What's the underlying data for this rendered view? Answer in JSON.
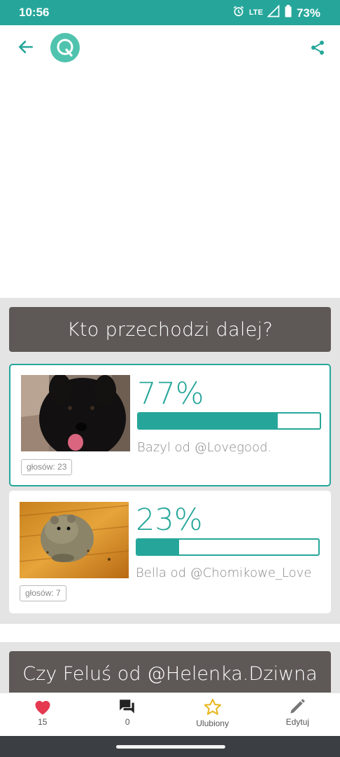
{
  "status_bar": {
    "time": "10:56",
    "network": "LTE",
    "battery": "73%"
  },
  "app_bar": {
    "logo_letter": "Q"
  },
  "poll": {
    "question": "Kto przechodzi dalej?",
    "options": [
      {
        "percent_label": "77%",
        "percent": 77,
        "label": "Bazyl od @Lovegood.",
        "votes": "głosów: 23",
        "selected": true
      },
      {
        "percent_label": "23%",
        "percent": 23,
        "label": "Bella od @Chomikowe_Love",
        "votes": "głosów: 7",
        "selected": false
      }
    ]
  },
  "next_poll": {
    "question": "Czy Feluś od @Helenka.Dziwna"
  },
  "bottom_nav": {
    "likes": {
      "label": "15",
      "icon": "heart-icon",
      "color": "#e53950"
    },
    "comments": {
      "label": "0",
      "icon": "forum-icon",
      "color": "#222222"
    },
    "favorite": {
      "label": "Ulubiony",
      "icon": "star-outline-icon",
      "color": "#e8b820"
    },
    "edit": {
      "label": "Edytuj",
      "icon": "pencil-icon",
      "color": "#777777"
    }
  },
  "colors": {
    "accent": "#26a69a",
    "header_bar": "#5e5856"
  }
}
